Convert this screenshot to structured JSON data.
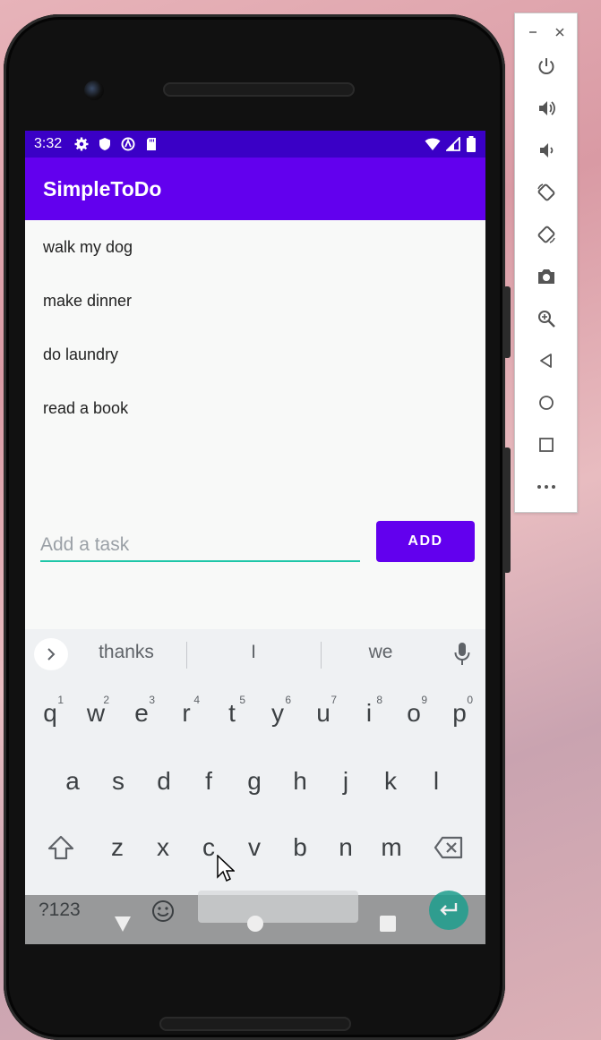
{
  "status_bar": {
    "time": "3:32",
    "left_icons": [
      "gear-icon",
      "shield-icon",
      "vpn-icon",
      "sd-card-icon"
    ],
    "right_icons": [
      "wifi-icon",
      "signal-icon",
      "battery-icon"
    ]
  },
  "app_bar": {
    "title": "SimpleToDo"
  },
  "tasks": [
    {
      "label": "walk my dog"
    },
    {
      "label": "make dinner"
    },
    {
      "label": "do laundry"
    },
    {
      "label": "read a book"
    }
  ],
  "task_input": {
    "placeholder": "Add a task",
    "value": ""
  },
  "add_button": {
    "label": "ADD"
  },
  "keyboard": {
    "suggestions": [
      "thanks",
      "I",
      "we"
    ],
    "row1": [
      {
        "k": "q",
        "n": "1"
      },
      {
        "k": "w",
        "n": "2"
      },
      {
        "k": "e",
        "n": "3"
      },
      {
        "k": "r",
        "n": "4"
      },
      {
        "k": "t",
        "n": "5"
      },
      {
        "k": "y",
        "n": "6"
      },
      {
        "k": "u",
        "n": "7"
      },
      {
        "k": "i",
        "n": "8"
      },
      {
        "k": "o",
        "n": "9"
      },
      {
        "k": "p",
        "n": "0"
      }
    ],
    "row2": [
      "a",
      "s",
      "d",
      "f",
      "g",
      "h",
      "j",
      "k",
      "l"
    ],
    "row3": [
      "z",
      "x",
      "c",
      "v",
      "b",
      "n",
      "m"
    ],
    "symbols_key": "?123",
    "accent_color": "#1d9e8e"
  },
  "colors": {
    "primary": "#6200ee",
    "primary_dark": "#3a00c6",
    "input_underline": "#1ec6a8"
  },
  "emulator_toolbar": {
    "window_controls": [
      "minimize-icon",
      "close-icon"
    ],
    "buttons": [
      "power-icon",
      "volume-up-icon",
      "volume-down-icon",
      "rotate-left-icon",
      "rotate-right-icon",
      "camera-icon",
      "zoom-icon",
      "back-icon",
      "home-icon",
      "overview-icon",
      "more-icon"
    ]
  }
}
